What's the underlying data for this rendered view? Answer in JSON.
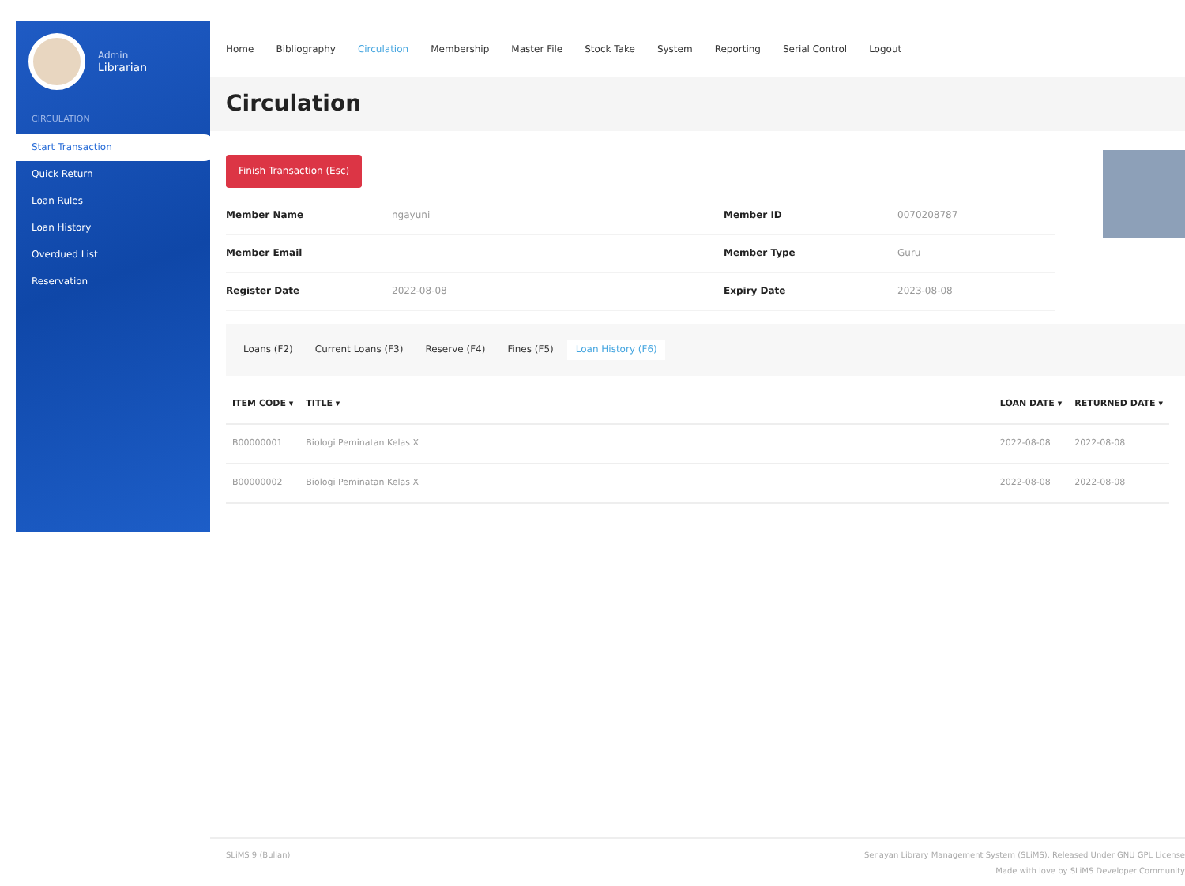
{
  "sidebar": {
    "user": {
      "name": "Admin",
      "role": "Librarian"
    },
    "section": "CIRCULATION",
    "items": [
      {
        "label": "Start Transaction",
        "selected": true
      },
      {
        "label": "Quick Return",
        "selected": false
      },
      {
        "label": "Loan Rules",
        "selected": false
      },
      {
        "label": "Loan History",
        "selected": false
      },
      {
        "label": "Overdued List",
        "selected": false
      },
      {
        "label": "Reservation",
        "selected": false
      }
    ]
  },
  "nav": [
    {
      "label": "Home",
      "selected": false
    },
    {
      "label": "Bibliography",
      "selected": false
    },
    {
      "label": "Circulation",
      "selected": true
    },
    {
      "label": "Membership",
      "selected": false
    },
    {
      "label": "Master File",
      "selected": false
    },
    {
      "label": "Stock Take",
      "selected": false
    },
    {
      "label": "System",
      "selected": false
    },
    {
      "label": "Reporting",
      "selected": false
    },
    {
      "label": "Serial Control",
      "selected": false
    },
    {
      "label": "Logout",
      "selected": false
    }
  ],
  "page_title": "Circulation",
  "finish_button": "Finish Transaction (Esc)",
  "member": [
    {
      "label": "Member Name",
      "value": "ngayuni"
    },
    {
      "label": "Member ID",
      "value": "0070208787"
    },
    {
      "label": "Member Email"
    },
    {
      "label": "Member Type",
      "value": "Guru"
    },
    {
      "label": "Register Date",
      "value": "2022-08-08"
    },
    {
      "label": "Expiry Date",
      "value": "2023-08-08"
    }
  ],
  "tabs": [
    {
      "label": "Loans (F2)",
      "selected": false
    },
    {
      "label": "Current Loans (F3)",
      "selected": false
    },
    {
      "label": "Reserve (F4)",
      "selected": false
    },
    {
      "label": "Fines (F5)",
      "selected": false
    },
    {
      "label": "Loan History (F6)",
      "selected": true
    }
  ],
  "table": {
    "columns": [
      "ITEM CODE ▾",
      "TITLE ▾",
      "LOAN DATE ▾",
      "RETURNED DATE ▾"
    ],
    "rows": [
      [
        "B00000001",
        "Biologi Peminatan Kelas X",
        "2022-08-08",
        "2022-08-08"
      ],
      [
        "B00000002",
        "Biologi Peminatan Kelas X",
        "2022-08-08",
        "2022-08-08"
      ]
    ]
  },
  "footer": {
    "version": "SLiMS 9 (Bulian)",
    "license": "Senayan Library Management System (SLiMS). Released Under GNU GPL License",
    "credit": "Made with love by SLiMS Developer Community"
  }
}
